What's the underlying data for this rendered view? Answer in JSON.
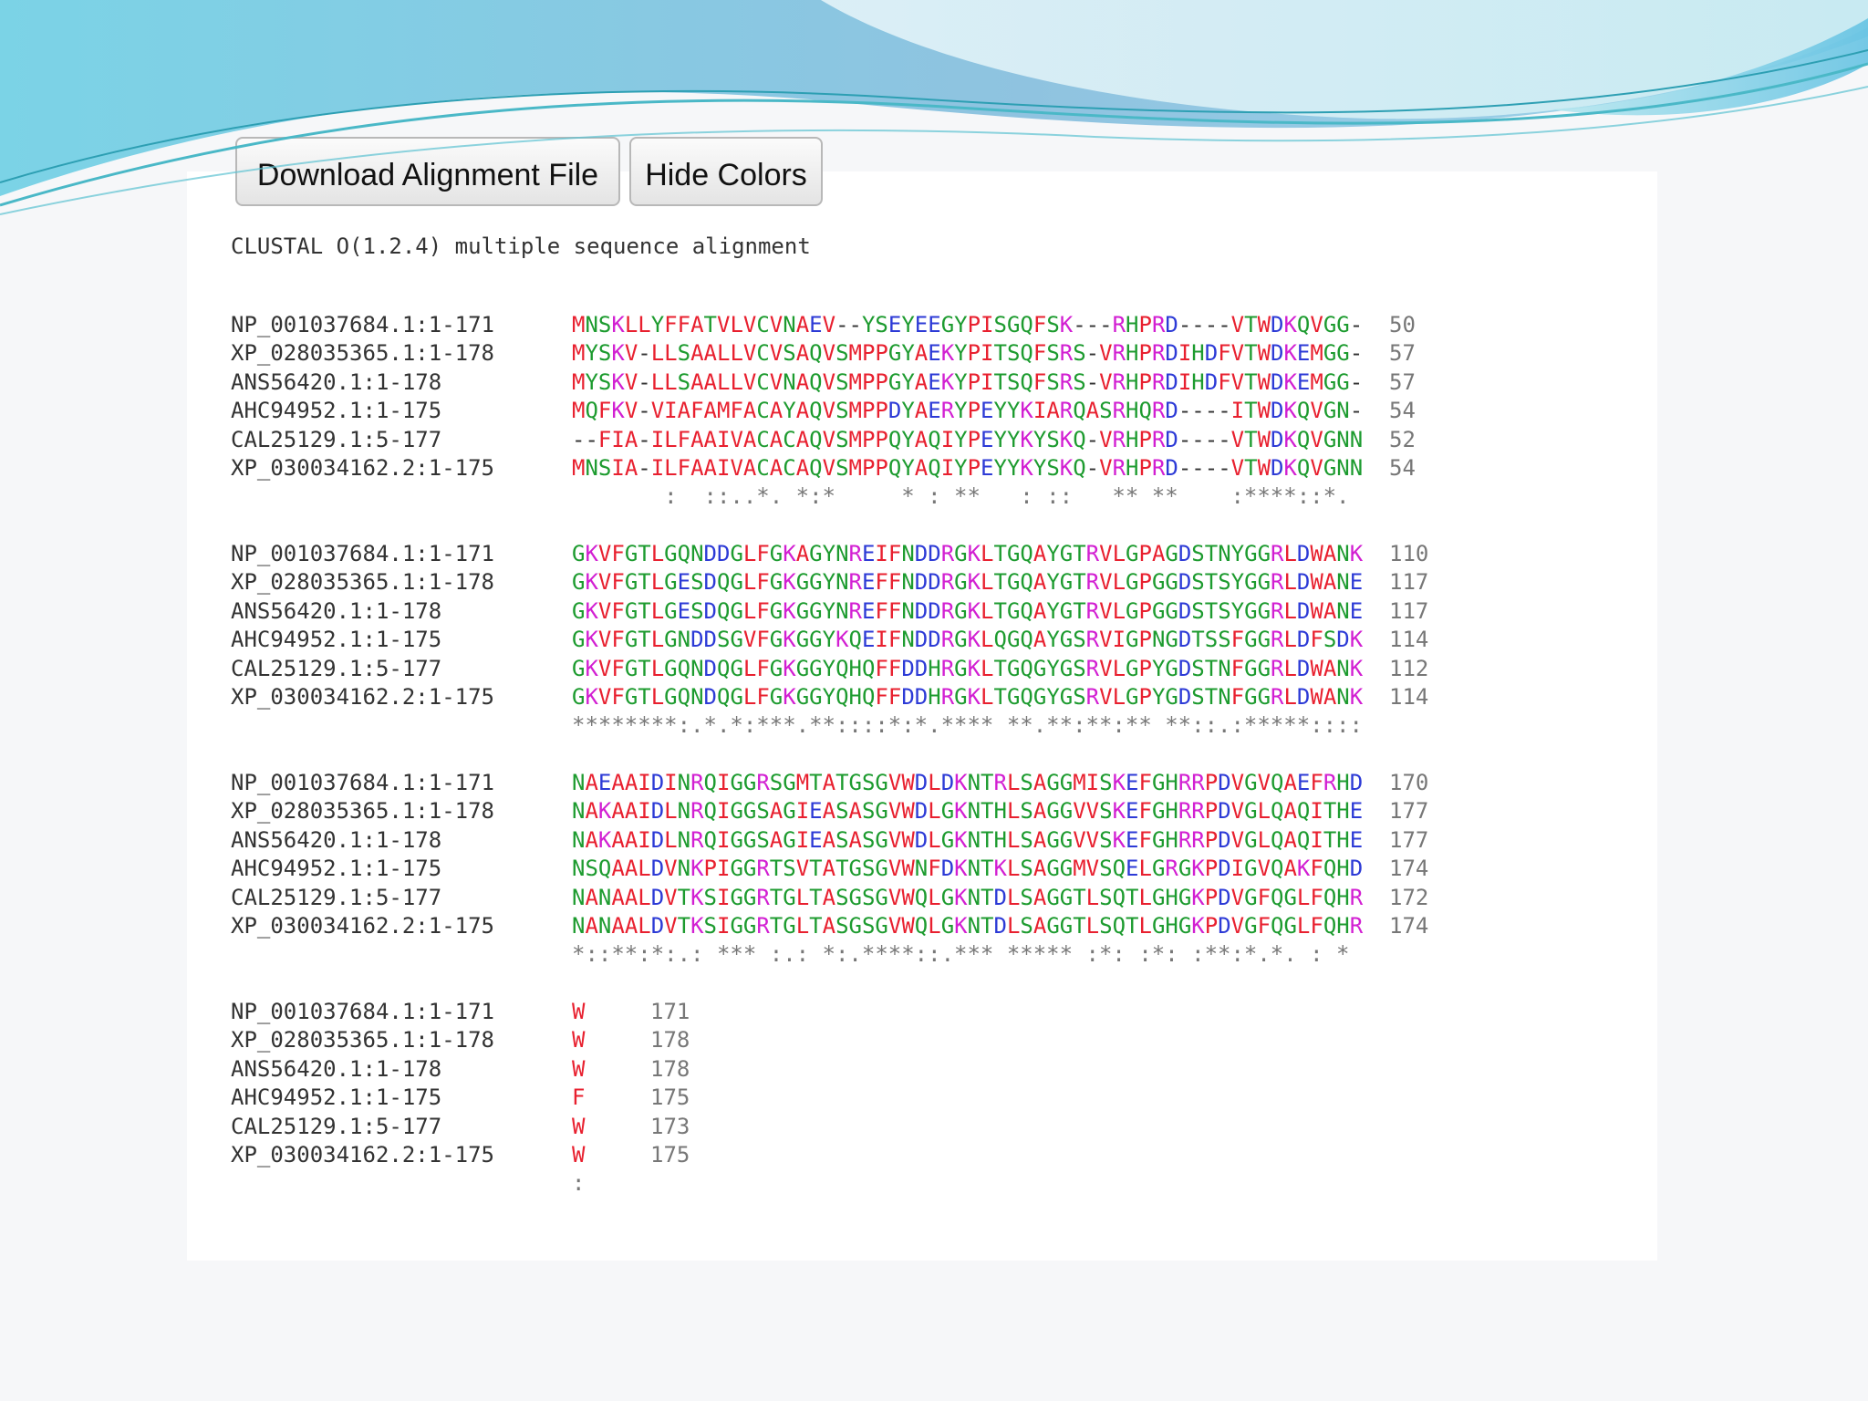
{
  "buttons": {
    "download": "Download Alignment File",
    "hide_colors": "Hide Colors"
  },
  "header": "CLUSTAL O(1.2.4) multiple sequence alignment",
  "colors": {
    "hydrophobic_red": "#e8202f",
    "polar_green": "#1d9b2f",
    "acidic_blue": "#2c3ad6",
    "basic_magenta": "#d21fd2",
    "counts_gray": "#777777"
  },
  "alignment": {
    "blocks": [
      {
        "rows": [
          {
            "name": "NP_001037684.1:1-171",
            "seq": "MNSKLLYFFATVLVCVNAEV--YSEYEEGYPISGQFSK---RHPRD----VTWDKQVGG-",
            "count": "50"
          },
          {
            "name": "XP_028035365.1:1-178",
            "seq": "MYSKV-LLSAALLVCVSAQVSMPPGYAEKYPITSQFSRS-VRHPRDIHDFVTWDKEMGG-",
            "count": "57"
          },
          {
            "name": "ANS56420.1:1-178",
            "seq": "MYSKV-LLSAALLVCVNAQVSMPPGYAEKYPITSQFSRS-VRHPRDIHDFVTWDKEMGG-",
            "count": "57"
          },
          {
            "name": "AHC94952.1:1-175",
            "seq": "MQFKV-VIAFAMFACAYAQVSMPPDYAERYPEYYKIARQASRHQRD----ITWDKQVGN-",
            "count": "54"
          },
          {
            "name": "CAL25129.1:5-177",
            "seq": "--FIA-ILFAAIVACACAQVSMPPQYAQIYPEYYKYSKQ-VRHPRD----VTWDKQVGNN",
            "count": "52"
          },
          {
            "name": "XP_030034162.2:1-175",
            "seq": "MNSIA-ILFAAIVACACAQVSMPPQYAQIYPEYYKYSKQ-VRHPRD----VTWDKQVGNN",
            "count": "54"
          }
        ],
        "consensus": "       :  ::..*. *:*     * : **   : ::   ** **    :****::*."
      },
      {
        "rows": [
          {
            "name": "NP_001037684.1:1-171",
            "seq": "GKVFGTLGQNDDGLFGKAGYNREIFNDDRGKLTGQAYGTRVLGPAGDSTNYGGRLDWANK",
            "count": "110"
          },
          {
            "name": "XP_028035365.1:1-178",
            "seq": "GKVFGTLGESDQGLFGKGGYNREFFNDDRGKLTGQAYGTRVLGPGGDSTSYGGRLDWANE",
            "count": "117"
          },
          {
            "name": "ANS56420.1:1-178",
            "seq": "GKVFGTLGESDQGLFGKGGYNREFFNDDRGKLTGQAYGTRVLGPGGDSTSYGGRLDWANE",
            "count": "117"
          },
          {
            "name": "AHC94952.1:1-175",
            "seq": "GKVFGTLGNDDSGVFGKGGYKQEIFNDDRGKLQGQAYGSRVIGPNGDTSSFGGRLDFSDK",
            "count": "114"
          },
          {
            "name": "CAL25129.1:5-177",
            "seq": "GKVFGTLGQNDQGLFGKGGYQHQFFDDHRGKLTGQGYGSRVLGPYGDSTNFGGRLDWANK",
            "count": "112"
          },
          {
            "name": "XP_030034162.2:1-175",
            "seq": "GKVFGTLGQNDQGLFGKGGYQHQFFDDHRGKLTGQGYGSRVLGPYGDSTNFGGRLDWANK",
            "count": "114"
          }
        ],
        "consensus": "********:.*.*:***.**::::*:*.**** **.**:**:** **::.:*****::::"
      },
      {
        "rows": [
          {
            "name": "NP_001037684.1:1-171",
            "seq": "NAEAAIDINRQIGGRSGMTATGSGVWDLDKNTRLSAGGMISKEFGHRRPDVGVQAEFRHD",
            "count": "170"
          },
          {
            "name": "XP_028035365.1:1-178",
            "seq": "NAKAAIDLNRQIGGSAGIEASASGVWDLGKNTHLSAGGVVSKEFGHRRPDVGLQAQITHE",
            "count": "177"
          },
          {
            "name": "ANS56420.1:1-178",
            "seq": "NAKAAIDLNRQIGGSAGIEASASGVWDLGKNTHLSAGGVVSKEFGHRRPDVGLQAQITHE",
            "count": "177"
          },
          {
            "name": "AHC94952.1:1-175",
            "seq": "NSQAALDVNKPIGGRTSVTATGSGVWNFDKNTKLSAGGMVSQELGRGKPDIGVQAKFQHD",
            "count": "174"
          },
          {
            "name": "CAL25129.1:5-177",
            "seq": "NANAALDVTKSIGGRTGLTASGSGVWQLGKNTDLSAGGTLSQTLGHGKPDVGFQGLFQHR",
            "count": "172"
          },
          {
            "name": "XP_030034162.2:1-175",
            "seq": "NANAALDVTKSIGGRTGLTASGSGVWQLGKNTDLSAGGTLSQTLGHGKPDVGFQGLFQHR",
            "count": "174"
          }
        ],
        "consensus": "*::**:*:.: *** :.: *:.****::.*** ***** :*: :*: :**:*.*. : *"
      },
      {
        "rows": [
          {
            "name": "NP_001037684.1:1-171",
            "seq": "W",
            "count": "171"
          },
          {
            "name": "XP_028035365.1:1-178",
            "seq": "W",
            "count": "178"
          },
          {
            "name": "ANS56420.1:1-178",
            "seq": "W",
            "count": "178"
          },
          {
            "name": "AHC94952.1:1-175",
            "seq": "F",
            "count": "175"
          },
          {
            "name": "CAL25129.1:5-177",
            "seq": "W",
            "count": "173"
          },
          {
            "name": "XP_030034162.2:1-175",
            "seq": "W",
            "count": "175"
          }
        ],
        "consensus": ":"
      }
    ]
  }
}
